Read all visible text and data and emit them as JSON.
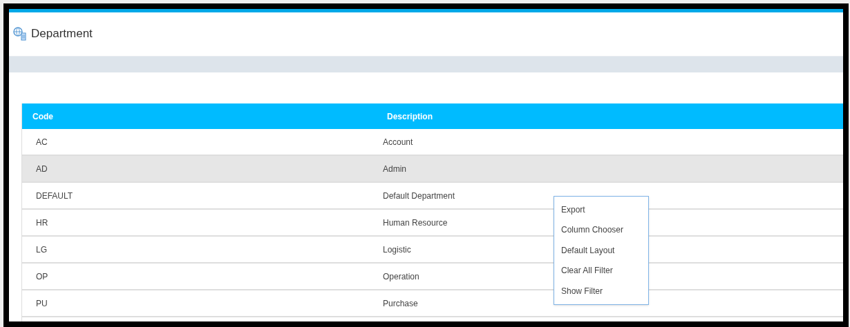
{
  "page": {
    "title": "Department"
  },
  "table": {
    "columns": [
      "Code",
      "Description"
    ],
    "rows": [
      {
        "cells": [
          "AC",
          "Account"
        ],
        "selected": false
      },
      {
        "cells": [
          "AD",
          "Admin"
        ],
        "selected": true
      },
      {
        "cells": [
          "DEFAULT",
          "Default Department"
        ],
        "selected": false
      },
      {
        "cells": [
          "HR",
          "Human Resource"
        ],
        "selected": false
      },
      {
        "cells": [
          "LG",
          "Logistic"
        ],
        "selected": false
      },
      {
        "cells": [
          "OP",
          "Operation"
        ],
        "selected": false
      },
      {
        "cells": [
          "PU",
          "Purchase"
        ],
        "selected": false
      }
    ]
  },
  "context_menu": {
    "items": [
      "Export",
      "Column Chooser",
      "Default Layout",
      "Clear All Filter",
      "Show Filter"
    ]
  }
}
